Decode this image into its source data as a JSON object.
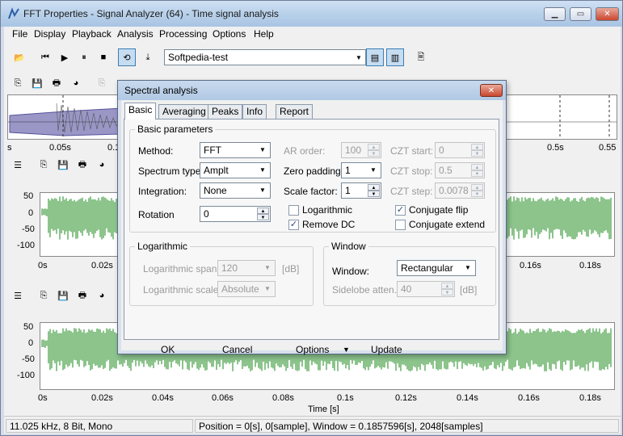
{
  "window": {
    "title": "FFT Properties - Signal Analyzer (64) - Time signal analysis"
  },
  "menu": [
    "File",
    "Display",
    "Playback",
    "Analysis",
    "Processing",
    "Options",
    "Help"
  ],
  "toolbar": {
    "signal_combo": "Softpedia-test"
  },
  "overview": {
    "ticks": [
      "s",
      "0.05s",
      "0.1s",
      "0.5s",
      "0.55"
    ]
  },
  "plot1": {
    "yticks": [
      "50",
      "0",
      "-50",
      "-100"
    ],
    "xticks": [
      "0s",
      "0.02s",
      "0.16s",
      "0.18s"
    ]
  },
  "plot2": {
    "yticks": [
      "50",
      "0",
      "-50",
      "-100"
    ],
    "xticks": [
      "0s",
      "0.02s",
      "0.04s",
      "0.06s",
      "0.08s",
      "0.1s",
      "0.12s",
      "0.14s",
      "0.16s",
      "0.18s"
    ],
    "xlabel": "Time [s]"
  },
  "status": {
    "format": "11.025 kHz, 8 Bit, Mono",
    "position": "Position = 0[s], 0[sample], Window = 0.1857596[s], 2048[samples]"
  },
  "dialog": {
    "title": "Spectral analysis",
    "tabs": [
      "Basic",
      "Averaging",
      "Peaks",
      "Info",
      "Report"
    ],
    "basic_group": "Basic parameters",
    "method_label": "Method:",
    "method_value": "FFT",
    "spectrum_label": "Spectrum type:",
    "spectrum_value": "Amplt",
    "integration_label": "Integration:",
    "integration_value": "None",
    "rotation_label": "Rotation",
    "rotation_value": "0",
    "ar_label": "AR order:",
    "ar_value": "100",
    "zero_label": "Zero padding:",
    "zero_value": "1",
    "scale_label": "Scale factor:",
    "scale_value": "1",
    "logarithmic_label": "Logarithmic",
    "remove_dc_label": "Remove DC",
    "czt_start_label": "CZT start:",
    "czt_start_value": "0",
    "czt_stop_label": "CZT stop:",
    "czt_stop_value": "0.5",
    "czt_step_label": "CZT step:",
    "czt_step_value": "0.0078",
    "conj_flip_label": "Conjugate flip",
    "conj_extend_label": "Conjugate extend",
    "log_group": "Logarithmic",
    "log_span_label": "Logarithmic span:",
    "log_span_value": "120",
    "log_span_unit": "[dB]",
    "log_scale_label": "Logarithmic scale:",
    "log_scale_value": "Absolute",
    "window_group": "Window",
    "window_label": "Window:",
    "window_value": "Rectangular",
    "sidelobe_label": "Sidelobe atten.:",
    "sidelobe_value": "40",
    "sidelobe_unit": "[dB]",
    "ok": "OK",
    "cancel": "Cancel",
    "options": "Options",
    "update": "Update"
  }
}
